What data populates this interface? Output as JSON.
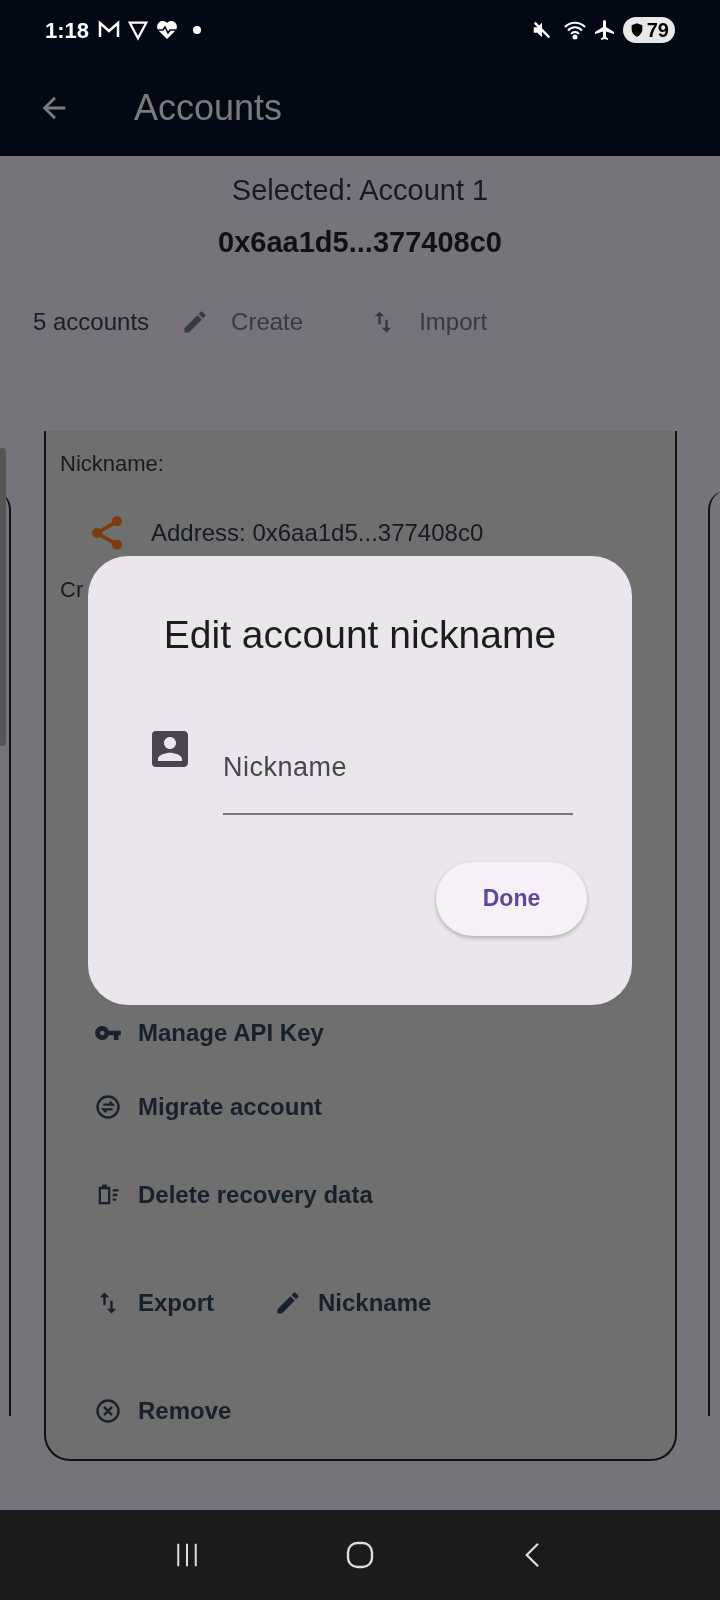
{
  "status_bar": {
    "time": "1:18",
    "battery": "79"
  },
  "app_bar": {
    "title": "Accounts"
  },
  "header": {
    "selected": "Selected: Account 1",
    "address": "0x6aa1d5...377408c0"
  },
  "toolbar": {
    "count": "5 accounts",
    "actions": [
      {
        "label": "Create",
        "kind": "edit"
      },
      {
        "label": "Import",
        "kind": "swap"
      }
    ]
  },
  "card": {
    "nickname_label": "Nickname:",
    "address": "Address: 0x6aa1d5...377408c0",
    "partial_label": "Cr",
    "rows": [
      [
        {
          "label": "Manage API Key",
          "kind": "key"
        }
      ],
      [
        {
          "label": "Migrate account",
          "kind": "migrate"
        }
      ],
      [
        {
          "label": "Delete recovery data",
          "kind": "sweep"
        }
      ],
      [
        {
          "label": "Export",
          "kind": "swap"
        },
        {
          "label": "Nickname",
          "kind": "edit"
        }
      ],
      [
        {
          "label": "Remove",
          "kind": "cancel"
        }
      ]
    ]
  },
  "dialog": {
    "title": "Edit account nickname",
    "field": {
      "placeholder": "Nickname"
    },
    "button": "Done"
  }
}
